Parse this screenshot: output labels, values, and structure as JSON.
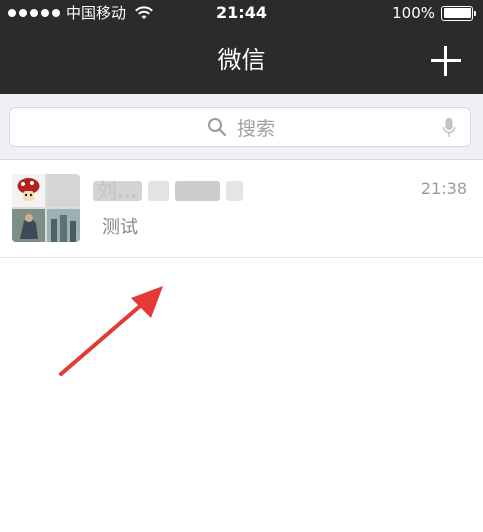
{
  "status_bar": {
    "carrier": "中国移动",
    "time": "21:44",
    "battery": "100%",
    "battery_level": 1.0,
    "signal_bars": 5
  },
  "nav": {
    "title": "微信",
    "add_icon": "plus-icon"
  },
  "search": {
    "placeholder": "搜索",
    "icons": [
      "search-icon",
      "microphone-icon"
    ]
  },
  "chats": [
    {
      "name": "刘…",
      "name_blurred": true,
      "last_message": "测试",
      "time": "21:38",
      "avatar": "group-avatar-grid"
    }
  ],
  "colors": {
    "nav_bg": "#2b2b2b",
    "search_area_bg": "#efeff4",
    "annotation_arrow": "#e53935"
  }
}
